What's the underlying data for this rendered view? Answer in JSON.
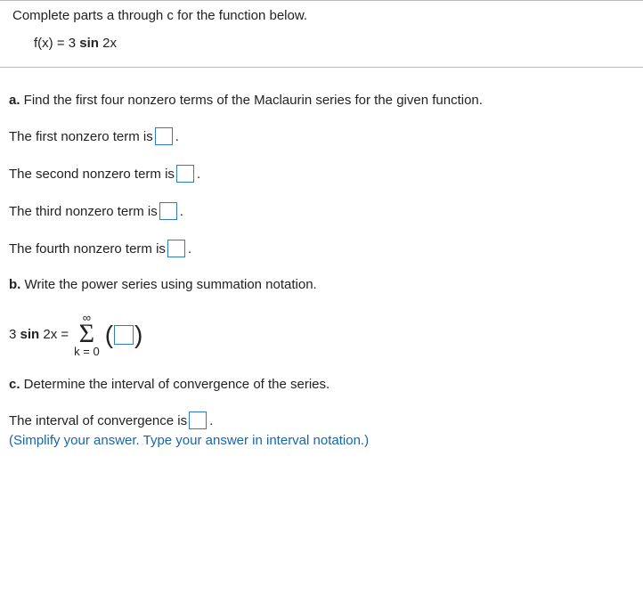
{
  "header": {
    "instruction": "Complete parts a through c for the function below.",
    "fn_prefix": "f(x) = 3 ",
    "fn_sin": "sin",
    "fn_suffix": " 2x"
  },
  "partA": {
    "prefix": "a.",
    "prompt": " Find the first four nonzero terms of the Maclaurin series for the given function.",
    "line1_before": "The first nonzero term is ",
    "line2_before": "The second nonzero term is ",
    "line3_before": "The third nonzero term is ",
    "line4_before": "The fourth nonzero term is ",
    "period": "."
  },
  "partB": {
    "prefix": "b.",
    "prompt": " Write the power series using summation notation.",
    "lhs_pre": "3 ",
    "lhs_sin": "sin",
    "lhs_post": " 2x = ",
    "sigma_top": "∞",
    "sigma_bottom": "k = 0"
  },
  "partC": {
    "prefix": "c.",
    "prompt": " Determine the interval of convergence of the series.",
    "answer_before": "The interval of convergence is ",
    "period": ".",
    "hint": "(Simplify your answer. Type your answer in interval notation.)"
  }
}
